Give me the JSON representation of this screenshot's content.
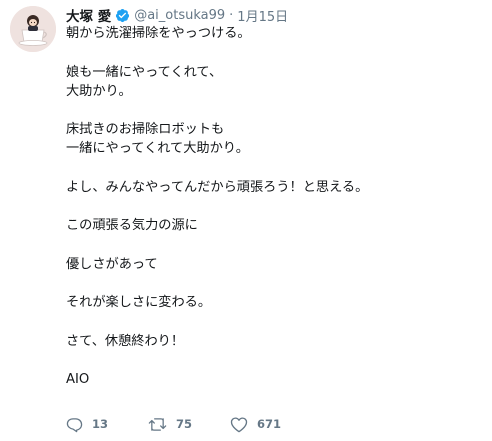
{
  "tweet": {
    "author": {
      "display_name": "大塚 愛",
      "verified_icon": "verified-badge-icon",
      "handle": "@ai_otsuka99",
      "separator": "·",
      "date": "1月15日"
    },
    "lines": [
      "朝から洗濯掃除をやっつける。",
      "",
      "娘も一緒にやってくれて、",
      "大助かり。",
      "",
      "床拭きのお掃除ロボットも",
      "一緒にやってくれて大助かり。",
      "",
      "よし、みんなやってんだから頑張ろう！と思える。",
      "",
      "この頑張る気力の源に",
      "",
      "優しさがあって",
      "",
      "それが楽しさに変わる。",
      "",
      "さて、休憩終わり！",
      "",
      "AIO"
    ],
    "actions": {
      "reply": {
        "icon": "reply-icon",
        "count": "13"
      },
      "retweet": {
        "icon": "retweet-icon",
        "count": "75"
      },
      "like": {
        "icon": "heart-icon",
        "count": "671"
      }
    },
    "colors": {
      "text": "#14171a",
      "secondary": "#657786",
      "verified": "#1da1f2"
    }
  }
}
